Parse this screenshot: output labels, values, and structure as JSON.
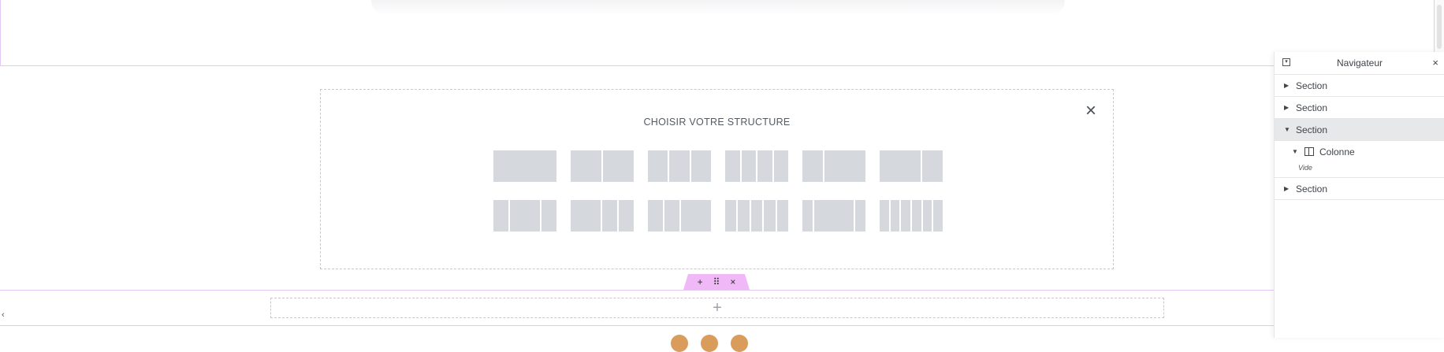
{
  "structure_picker": {
    "title": "CHOISIR VOTRE STRUCTURE",
    "close_icon": "×",
    "presets_row1": [
      [
        1
      ],
      [
        1,
        1
      ],
      [
        1,
        1,
        1
      ],
      [
        1,
        1,
        1,
        1
      ],
      [
        1,
        2
      ],
      [
        2,
        1
      ]
    ],
    "presets_row2": [
      [
        1,
        2,
        1
      ],
      [
        2,
        1,
        1
      ],
      [
        1,
        1,
        2
      ],
      [
        1,
        1,
        1,
        1,
        1
      ],
      [
        1,
        4,
        1
      ],
      [
        1,
        1,
        1,
        1,
        1,
        1
      ]
    ]
  },
  "section_handle": {
    "add": "+",
    "drag": "⠿",
    "delete": "×"
  },
  "add_section": {
    "plus": "+"
  },
  "left_toggle": "‹",
  "navigator": {
    "title": "Navigateur",
    "close": "×",
    "toggle": "▾",
    "items": [
      {
        "label": "Section",
        "caret": "▶"
      },
      {
        "label": "Section",
        "caret": "▶"
      },
      {
        "label": "Section",
        "caret": "▼"
      },
      {
        "label": "Section",
        "caret": "▶"
      }
    ],
    "column_label": "Colonne",
    "column_caret": "▼",
    "empty_label": "Vide"
  },
  "colors": {
    "section_border": "#e3c8f6",
    "handle_bg": "#f0b8f7",
    "preset_fill": "#d5d8dc"
  }
}
